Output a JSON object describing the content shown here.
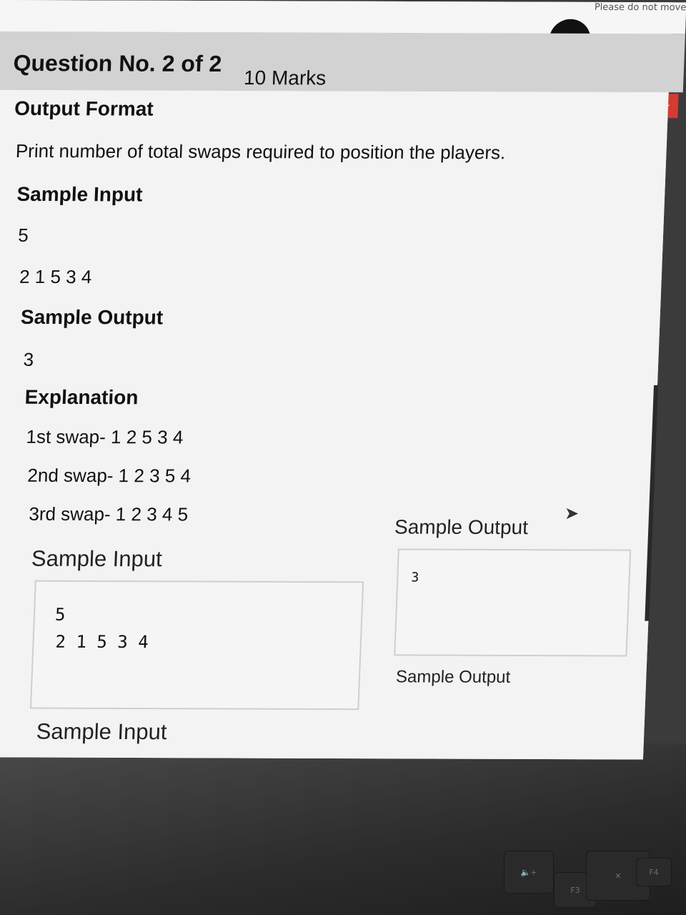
{
  "header": {
    "notice_text": "Please do not move",
    "question_label": "Question No.  2 of  2",
    "marks": "10 Marks"
  },
  "problem": {
    "output_format_heading": "Output Format",
    "output_format_text": "Print number of total swaps required to position the players.",
    "sample_input_heading": "Sample Input",
    "sample_input_line1": "5",
    "sample_input_line2": "2 1 5 3 4",
    "sample_output_heading": "Sample Output",
    "sample_output_value": "3",
    "explanation_heading": "Explanation",
    "explanation_lines": [
      "1st swap- 1 2 5 3 4",
      "2nd swap- 1 2 3 5 4",
      "3rd swap- 1 2 3 4 5"
    ]
  },
  "testcases": {
    "case1_input_label": "Sample Input",
    "case1_input_line1": "5",
    "case1_input_line2": "2  1  5  3  4",
    "case1_output_label": "Sample Output",
    "case1_output_value": "3",
    "case2_input_label": "Sample Input",
    "case2_output_label": "Sample Output"
  },
  "keyboard": {
    "key_f3": "F3",
    "key_f4": "F4"
  },
  "colors": {
    "pin_button": "#d43b32",
    "question_bar": "#d2d2d2"
  },
  "icons": {
    "pin": "pin-icon",
    "cursor": "mouse-cursor-icon",
    "volume": "volume-up-icon",
    "mic": "mic-mute-icon"
  }
}
